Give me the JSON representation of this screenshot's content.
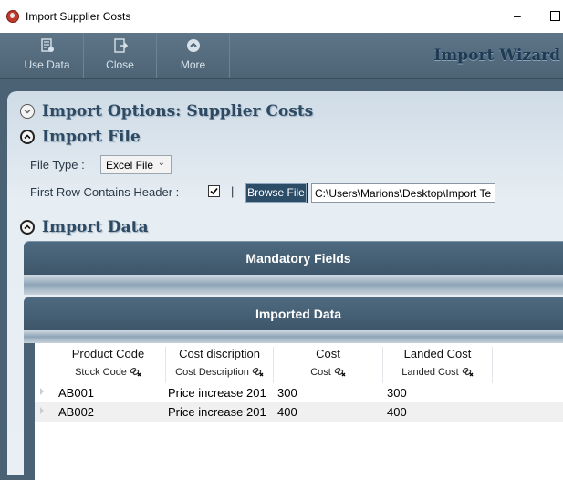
{
  "window": {
    "title": "Import Supplier Costs",
    "minimize_glyph": "–"
  },
  "toolbar": {
    "buttons": [
      {
        "label": "Use Data",
        "icon": "use-data-icon"
      },
      {
        "label": "Close",
        "icon": "close-icon"
      },
      {
        "label": "More",
        "icon": "more-icon"
      }
    ],
    "wizard_title": "Import Wizard"
  },
  "sections": {
    "options": "Import Options: Supplier Costs",
    "file": "Import File",
    "data": "Import Data"
  },
  "file": {
    "file_type_label": "File Type :",
    "file_type_value": "Excel File",
    "header_label": "First Row Contains Header :",
    "header_checked": true,
    "separator": "|",
    "browse_label": "Browse File",
    "path_value": "C:\\Users\\Marions\\Desktop\\Import Te"
  },
  "bars": {
    "mandatory": "Mandatory Fields",
    "imported": "Imported Data"
  },
  "grid": {
    "columns": [
      {
        "title": "Product Code",
        "mapping": "Stock Code"
      },
      {
        "title": "Cost discription",
        "mapping": "Cost Description"
      },
      {
        "title": "Cost",
        "mapping": "Cost"
      },
      {
        "title": "Landed Cost",
        "mapping": "Landed Cost"
      }
    ],
    "rows": [
      [
        "AB001",
        "Price increase 201",
        "300",
        "300"
      ],
      [
        "AB002",
        "Price increase 201",
        "400",
        "400"
      ]
    ]
  },
  "colors": {
    "toolbar": "#4c6475",
    "panel": "#e6edf3",
    "bar": "#3e566a",
    "browse": "#2c4d68"
  }
}
